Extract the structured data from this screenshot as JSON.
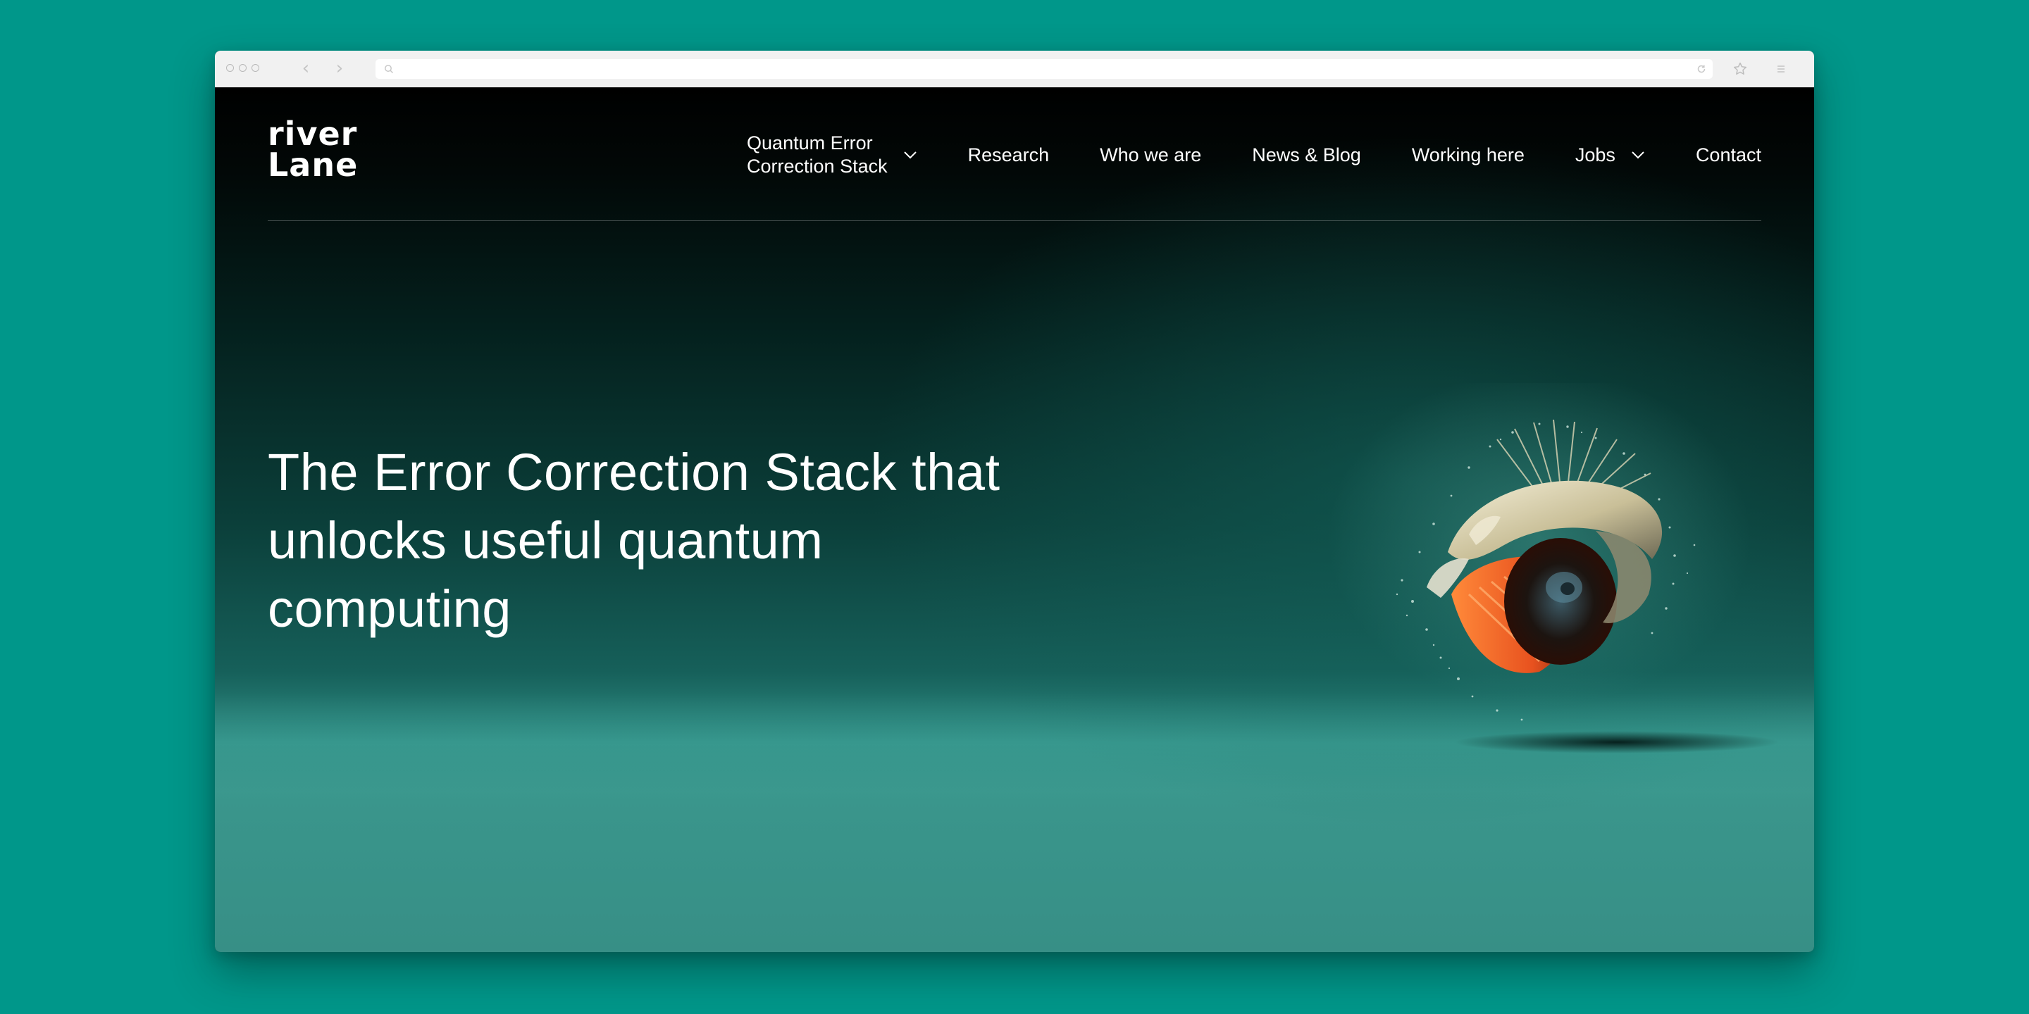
{
  "brand": {
    "logo_line1": "river",
    "logo_line2": "Lane"
  },
  "nav": {
    "items": [
      {
        "label": "Quantum Error\nCorrection Stack",
        "has_dropdown": true
      },
      {
        "label": "Research",
        "has_dropdown": false
      },
      {
        "label": "Who we are",
        "has_dropdown": false
      },
      {
        "label": "News & Blog",
        "has_dropdown": false
      },
      {
        "label": "Working here",
        "has_dropdown": false
      },
      {
        "label": "Jobs",
        "has_dropdown": true
      },
      {
        "label": "Contact",
        "has_dropdown": false
      }
    ]
  },
  "hero": {
    "title": "The Error Correction Stack that unlocks useful quantum computing"
  },
  "colors": {
    "background": "#00978a",
    "page_dark": "#000000",
    "teal_floor": "#3a968c",
    "accent_orange": "#e8521f",
    "text": "#ffffff"
  }
}
